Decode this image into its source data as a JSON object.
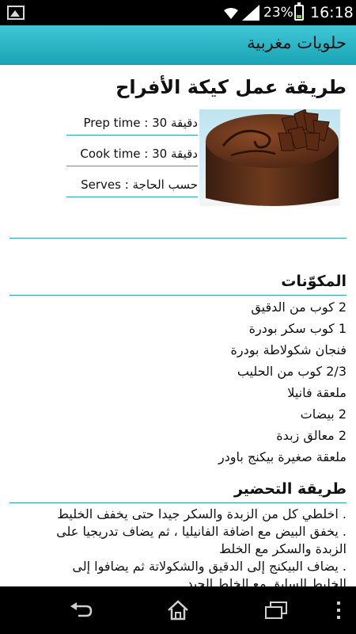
{
  "status_bar": {
    "battery_percent": "23%",
    "time": "16:18",
    "icons": [
      "gallery-notification-icon",
      "wifi-icon",
      "signal-icon",
      "battery-icon"
    ]
  },
  "app_bar": {
    "title": "حلويات مغربية"
  },
  "recipe": {
    "title": "طريقة عمل كيكة الأفراح",
    "prep_time": "Prep time : 30 دقيقة",
    "cook_time": "Cook time : 30 دقيقة",
    "serves": "Serves : حسب الحاجة"
  },
  "ingredients": {
    "heading": "المكوّنات",
    "items": [
      "2 كوب من الدقيق",
      "1 كوب سكر بودرة",
      "فنجان شكولاطة بودرة",
      "2/3 كوب من الحليب",
      "ملعقة فانيلا",
      "2 بيضات",
      "2 معالق زبدة",
      "ملعقة صغيرة بيكنج باودر"
    ]
  },
  "preparation": {
    "heading": "طريقة التحضير",
    "lines": [
      ". اخلطي كل من الزبدة والسكر جيدا حتى يخفف الخليط",
      ". يخفق البيض مع اضافة الفانيليا ، ثم يضاف تدريجيا على",
      "الزبدة والسكر مع الخلط",
      ". يضاف البيكنج إلى الدقيق والشكولاتة ثم يضافوا إلى",
      "الخليط السابق مع الخلط الجيد"
    ]
  },
  "colors": {
    "accent": "#1aa3b4",
    "divider": "#2aa7b8"
  },
  "nav_bar": {
    "icons": [
      "back-icon",
      "home-icon",
      "recent-apps-icon"
    ]
  }
}
